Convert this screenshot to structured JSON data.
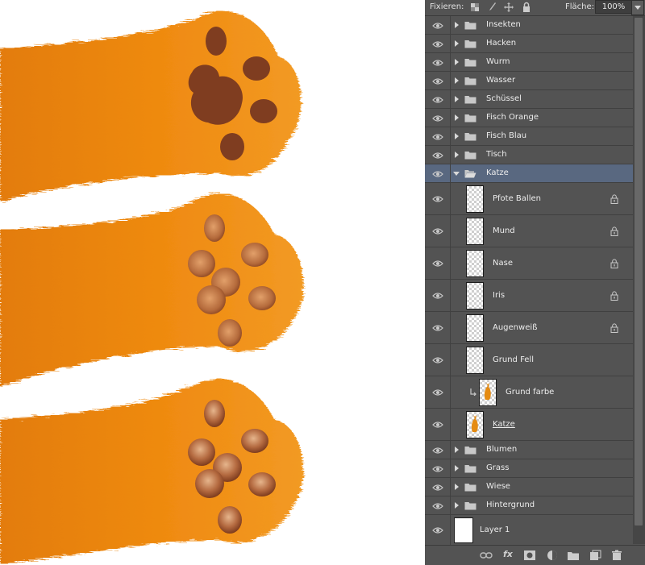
{
  "panel": {
    "lock_label": "Fixieren:",
    "fill_label": "Fläche:",
    "fill_value": "100%"
  },
  "layers": [
    {
      "name": "Insekten",
      "type": "group",
      "expanded": false
    },
    {
      "name": "Hacken",
      "type": "group",
      "expanded": false
    },
    {
      "name": "Wurm",
      "type": "group",
      "expanded": false
    },
    {
      "name": "Wasser",
      "type": "group",
      "expanded": false
    },
    {
      "name": "Schüssel",
      "type": "group",
      "expanded": false
    },
    {
      "name": "Fisch Orange",
      "type": "group",
      "expanded": false
    },
    {
      "name": "Fisch Blau",
      "type": "group",
      "expanded": false
    },
    {
      "name": "Tisch",
      "type": "group",
      "expanded": false
    },
    {
      "name": "Katze",
      "type": "group",
      "expanded": true,
      "selected": true
    },
    {
      "name": "Pfote Ballen",
      "type": "layer",
      "locked": true
    },
    {
      "name": "Mund",
      "type": "layer",
      "locked": true
    },
    {
      "name": "Nase",
      "type": "layer",
      "locked": true
    },
    {
      "name": "Iris",
      "type": "layer",
      "locked": true
    },
    {
      "name": "Augenweiß",
      "type": "layer",
      "locked": true
    },
    {
      "name": "Grund Fell",
      "type": "layer",
      "locked": false
    },
    {
      "name": "Grund farbe",
      "type": "layer",
      "clipped": true
    },
    {
      "name": "Katze",
      "type": "layer",
      "cat_thumb": true
    },
    {
      "name": "Blumen",
      "type": "group",
      "expanded": false
    },
    {
      "name": "Grass",
      "type": "group",
      "expanded": false
    },
    {
      "name": "Wiese",
      "type": "group",
      "expanded": false
    },
    {
      "name": "Hintergrund",
      "type": "group",
      "expanded": false
    },
    {
      "name": "Layer 1",
      "type": "background"
    }
  ],
  "icons": {
    "visibility": "eye-icon",
    "group": "folder-icon",
    "lock": "lock-icon",
    "bottom_bar": [
      "link-icon",
      "fx-icon",
      "mask-icon",
      "adjustment-icon",
      "group-icon",
      "new-layer-icon",
      "trash-icon"
    ]
  },
  "bottom_bar": {
    "fx_label": "fx"
  },
  "colors": {
    "panel_bg": "#535353",
    "selected_row": "#596880",
    "fur_orange": "#e8820f",
    "pad_dark": "#7a3a1c",
    "pad_medium": "#b86a3a"
  }
}
